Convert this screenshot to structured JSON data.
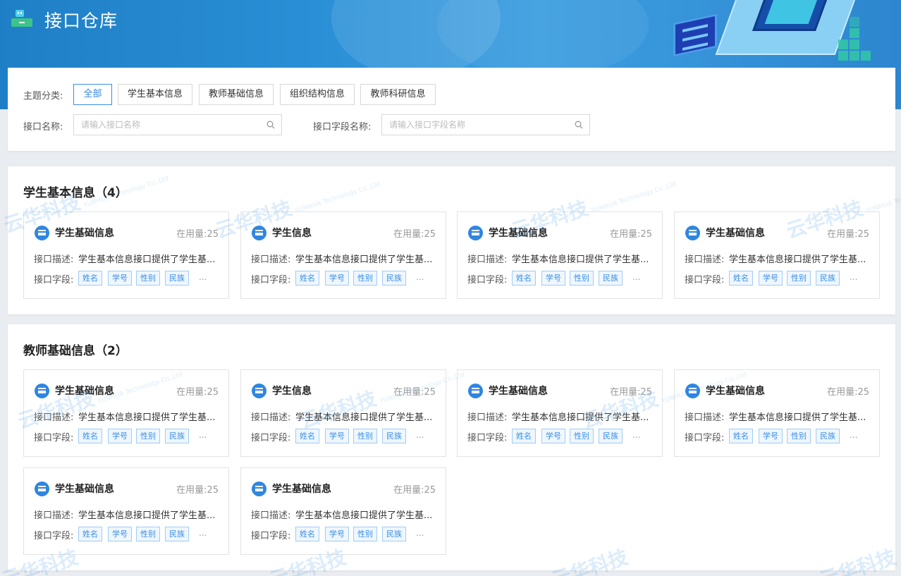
{
  "header": {
    "app_title": "接口仓库",
    "logo_icon": "database-icon"
  },
  "filter": {
    "category_label": "主题分类:",
    "categories": [
      {
        "label": "全部",
        "active": true
      },
      {
        "label": "学生基本信息",
        "active": false
      },
      {
        "label": "教师基础信息",
        "active": false
      },
      {
        "label": "组织结构信息",
        "active": false
      },
      {
        "label": "教师科研信息",
        "active": false
      }
    ],
    "api_name_label": "接口名称:",
    "api_name_placeholder": "请输入接口名称",
    "field_name_label": "接口字段名称:",
    "field_name_placeholder": "请输入接口字段名称",
    "search_icon": "search-icon"
  },
  "groups": [
    {
      "title": "学生基本信息（4）",
      "cards": [
        {
          "title": "学生基础信息",
          "usage": "在用量:25",
          "desc_label": "接口描述:",
          "desc": "学生基本信息接口提供了学生基...",
          "fields_label": "接口字段:",
          "tags": [
            "姓名",
            "学号",
            "性别",
            "民族"
          ],
          "more": "..."
        },
        {
          "title": "学生信息",
          "usage": "在用量:25",
          "desc_label": "接口描述:",
          "desc": "学生基本信息接口提供了学生基...",
          "fields_label": "接口字段:",
          "tags": [
            "姓名",
            "学号",
            "性别",
            "民族"
          ],
          "more": "..."
        },
        {
          "title": "学生基础信息",
          "usage": "在用量:25",
          "desc_label": "接口描述:",
          "desc": "学生基本信息接口提供了学生基...",
          "fields_label": "接口字段:",
          "tags": [
            "姓名",
            "学号",
            "性别",
            "民族"
          ],
          "more": "..."
        },
        {
          "title": "学生基础信息",
          "usage": "在用量:25",
          "desc_label": "接口描述:",
          "desc": "学生基本信息接口提供了学生基...",
          "fields_label": "接口字段:",
          "tags": [
            "姓名",
            "学号",
            "性别",
            "民族"
          ],
          "more": "..."
        }
      ]
    },
    {
      "title": "教师基础信息（2）",
      "cards": [
        {
          "title": "学生基础信息",
          "usage": "在用量:25",
          "desc_label": "接口描述:",
          "desc": "学生基本信息接口提供了学生基...",
          "fields_label": "接口字段:",
          "tags": [
            "姓名",
            "学号",
            "性别",
            "民族"
          ],
          "more": "..."
        },
        {
          "title": "学生信息",
          "usage": "在用量:25",
          "desc_label": "接口描述:",
          "desc": "学生基本信息接口提供了学生基...",
          "fields_label": "接口字段:",
          "tags": [
            "姓名",
            "学号",
            "性别",
            "民族"
          ],
          "more": "..."
        },
        {
          "title": "学生基础信息",
          "usage": "在用量:25",
          "desc_label": "接口描述:",
          "desc": "学生基本信息接口提供了学生基...",
          "fields_label": "接口字段:",
          "tags": [
            "姓名",
            "学号",
            "性别",
            "民族"
          ],
          "more": "..."
        },
        {
          "title": "学生基础信息",
          "usage": "在用量:25",
          "desc_label": "接口描述:",
          "desc": "学生基本信息接口提供了学生基...",
          "fields_label": "接口字段:",
          "tags": [
            "姓名",
            "学号",
            "性别",
            "民族"
          ],
          "more": "..."
        },
        {
          "title": "学生基础信息",
          "usage": "在用量:25",
          "desc_label": "接口描述:",
          "desc": "学生基本信息接口提供了学生基...",
          "fields_label": "接口字段:",
          "tags": [
            "姓名",
            "学号",
            "性别",
            "民族"
          ],
          "more": "..."
        },
        {
          "title": "学生基础信息",
          "usage": "在用量:25",
          "desc_label": "接口描述:",
          "desc": "学生基本信息接口提供了学生基...",
          "fields_label": "接口字段:",
          "tags": [
            "姓名",
            "学号",
            "性别",
            "民族"
          ],
          "more": "..."
        }
      ]
    }
  ],
  "watermark": {
    "text": "云华科技",
    "sub": "YUNHUA Technology Co.,Ltd"
  },
  "colors": {
    "accent": "#2f86e0",
    "banner": "#2a8fd6",
    "tag_border": "#9fcdf5"
  }
}
